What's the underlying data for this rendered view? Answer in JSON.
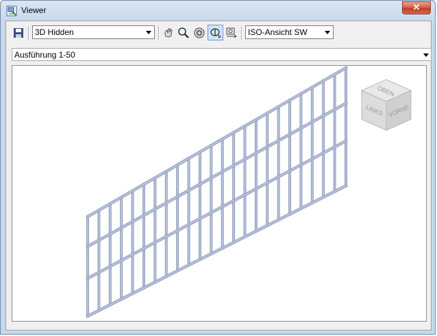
{
  "window": {
    "title": "Viewer",
    "close_glyph": "✕"
  },
  "toolbar": {
    "visual_style": "3D Hidden",
    "view_preset": "ISO-Ansicht SW",
    "icons": [
      "save-icon",
      "pan-icon",
      "zoom-icon",
      "zoom-extents-icon",
      "orbit-icon",
      "camera-settings-icon"
    ]
  },
  "layout_select": {
    "value": "Ausführung 1-50"
  },
  "viewcube": {
    "top": "OBEN",
    "left": "LINKS",
    "front": "VORNE"
  },
  "colors": {
    "mesh": "#b4bfd8",
    "mesh_edge": "#8e9bb8",
    "titlebar": "#c9d9ec",
    "close": "#c7452a"
  }
}
